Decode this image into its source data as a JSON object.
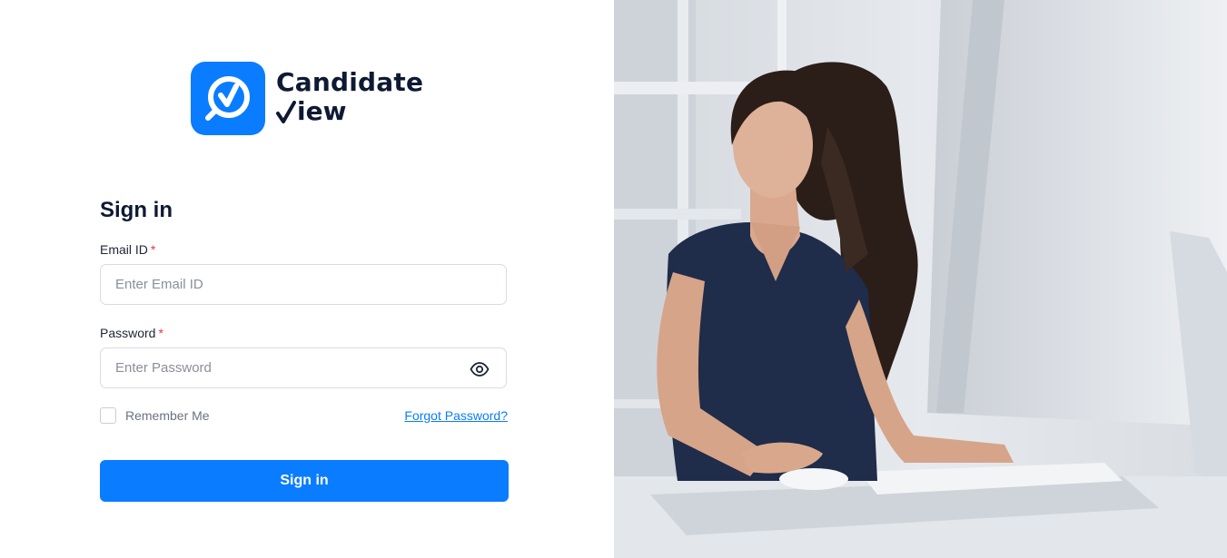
{
  "brand": {
    "name_line1": "Candidate",
    "name_line2": "iew",
    "logo_icon": "check-magnifier-icon",
    "accent_color": "#0a7cff"
  },
  "form": {
    "title": "Sign in",
    "email": {
      "label": "Email ID",
      "required_mark": "*",
      "placeholder": "Enter Email ID",
      "value": ""
    },
    "password": {
      "label": "Password",
      "required_mark": "*",
      "placeholder": "Enter Password",
      "value": "",
      "toggle_icon": "eye-icon"
    },
    "remember_me": {
      "label": "Remember Me",
      "checked": false
    },
    "forgot_password": "Forgot Password?",
    "submit_label": "Sign in"
  },
  "hero": {
    "image": "woman-at-computer-photo"
  }
}
